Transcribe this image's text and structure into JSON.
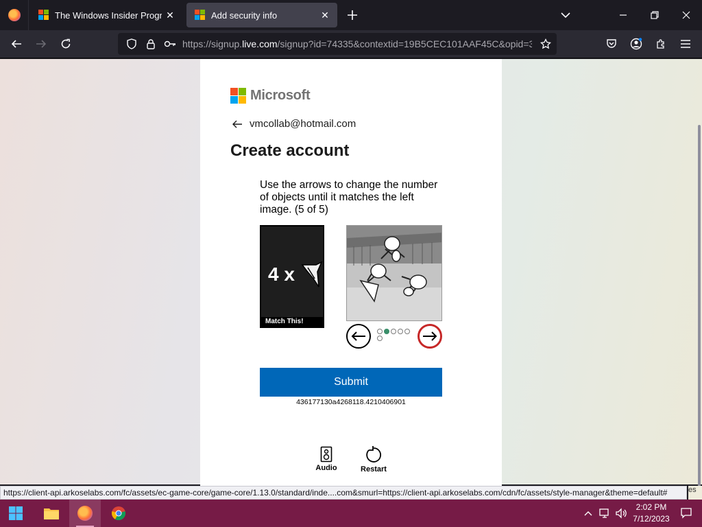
{
  "browser": {
    "tabs": [
      {
        "title": "The Windows Insider Program",
        "active": false
      },
      {
        "title": "Add security info",
        "active": true
      }
    ],
    "url_prefix": "https://signup.",
    "url_domain": "live.com",
    "url_suffix": "/signup?id=74335&contextid=19B5CEC101AAF45C&opid=3",
    "status_link": "https://client-api.arkoselabs.com/fc/assets/ec-game-core/game-core/1.13.0/standard/inde....com&smurl=https://client-api.arkoselabs.com/cdn/fc/assets/style-manager&theme=default#",
    "status_tail": "es"
  },
  "page": {
    "brand": "Microsoft",
    "email": "vmcollab@hotmail.com",
    "title": "Create account",
    "challenge": {
      "instructions": "Use the arrows to change the number of objects until it matches the left image. (5 of 5)",
      "target_count": "4 x",
      "match_label": "Match This!",
      "progress_dots_total": 6,
      "progress_dots_filled": 1,
      "submit_label": "Submit",
      "session_id": "436177130a4268118.4210406901",
      "audio_label": "Audio",
      "restart_label": "Restart"
    }
  },
  "taskbar": {
    "time": "2:02 PM",
    "date": "7/12/2023"
  },
  "colors": {
    "primary_button": "#0067b8",
    "taskbar": "#761b46",
    "right_arrow_ring": "#c62828"
  }
}
